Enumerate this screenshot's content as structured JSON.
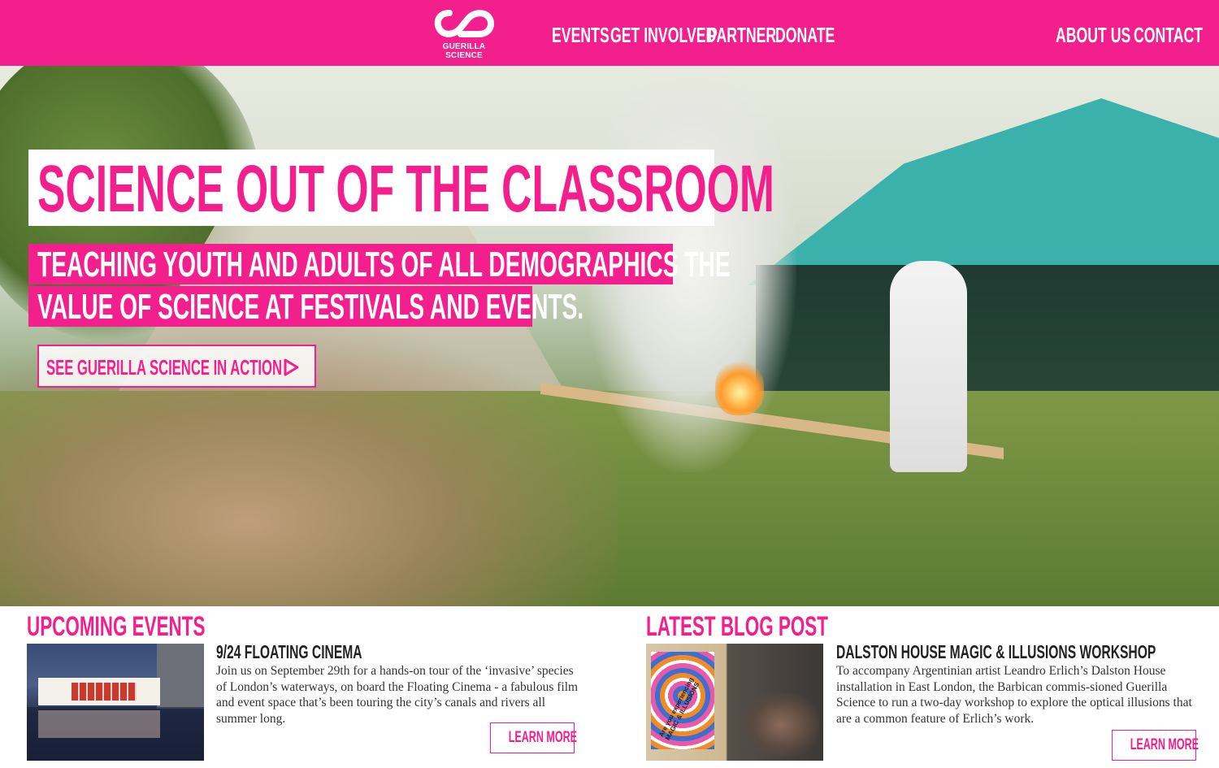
{
  "brand": {
    "logo_line1": "GUERILLA",
    "logo_line2": "SCIENCE",
    "color": "#f21f8c"
  },
  "nav": {
    "left": [
      "EVENTS",
      "GET INVOLVED",
      "PARTNER",
      "DONATE"
    ],
    "right": [
      "ABOUT US",
      "CONTACT"
    ]
  },
  "hero": {
    "title": "SCIENCE OUT OF THE CLASSROOM",
    "subtitle_line1": "TEACHING YOUTH AND ADULTS OF ALL DEMOGRAPHICS THE",
    "subtitle_line2": "VALUE OF SCIENCE AT FESTIVALS AND EVENTS.",
    "cta_label": "SEE GUERILLA SCIENCE IN ACTION",
    "cta_icon": "play-icon"
  },
  "events": {
    "heading": "UPCOMING EVENTS",
    "item_title": "9/24 FLOATING CINEMA",
    "item_body": "Join us on September 29th for a hands-on tour of the ‘invasive’ species of London’s waterways, on board the Floating Cinema - a fabulous film and event space that’s been touring the city’s canals and rivers all summer long.",
    "button": "LEARN MORE"
  },
  "blog": {
    "heading": "LATEST BLOG POST",
    "poster_small": "Are you experiencing",
    "poster_text": "MAGIC & ILLUSIONS",
    "item_title": "DALSTON HOUSE MAGIC & ILLUSIONS WORKSHOP",
    "item_body": "To accompany Argentinian artist Leandro Erlich’s Dalston House installation in East London, the Barbican commis-sioned Guerilla Science to run a two-day workshop to explore the optical illusions that are a common feature of Erlich’s work.",
    "button": "LEARN MORE"
  }
}
